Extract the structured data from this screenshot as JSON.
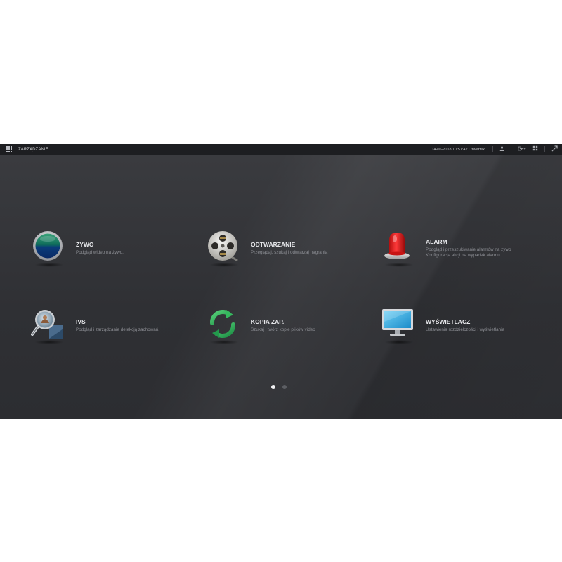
{
  "topbar": {
    "title": "ZARZĄDZANIE",
    "datetime": "14-06-2018 10:57:42 Czwartek"
  },
  "icons": {
    "menu": "grid-menu-icon",
    "user": "user-icon",
    "logout": "logout-icon",
    "layout": "layout-icon",
    "fullscreen": "fullscreen-icon"
  },
  "tiles": [
    {
      "name": "ŻYWO",
      "desc": [
        "Podgląd wideo na żywo."
      ],
      "icon": "live-view-icon"
    },
    {
      "name": "ODTWARZANIE",
      "desc": [
        "Przeglądaj, szukaj i odtwarzaj nagrania"
      ],
      "icon": "film-reel-icon"
    },
    {
      "name": "ALARM",
      "desc": [
        "Podgląd i przeszukiwanie alarmów na żywo",
        "Konfiguracja akcji na wypadek alarmu"
      ],
      "icon": "alarm-beacon-icon"
    },
    {
      "name": "IVS",
      "desc": [
        "Podgląd i zarządzanie detekcją zachowań."
      ],
      "icon": "magnifier-icon"
    },
    {
      "name": "KOPIA ZAP.",
      "desc": [
        "Szukaj i twórz kopie plików video"
      ],
      "icon": "backup-sync-icon"
    },
    {
      "name": "WYŚWIETLACZ",
      "desc": [
        "Ustawienia rozdzielczości i wyświetlania"
      ],
      "icon": "monitor-icon"
    }
  ],
  "pagination": {
    "pages": 2,
    "current": 1
  },
  "colors": {
    "accent_green": "#2fb35a",
    "alarm_red": "#e41c1c",
    "monitor_blue": "#1e9bd6"
  }
}
